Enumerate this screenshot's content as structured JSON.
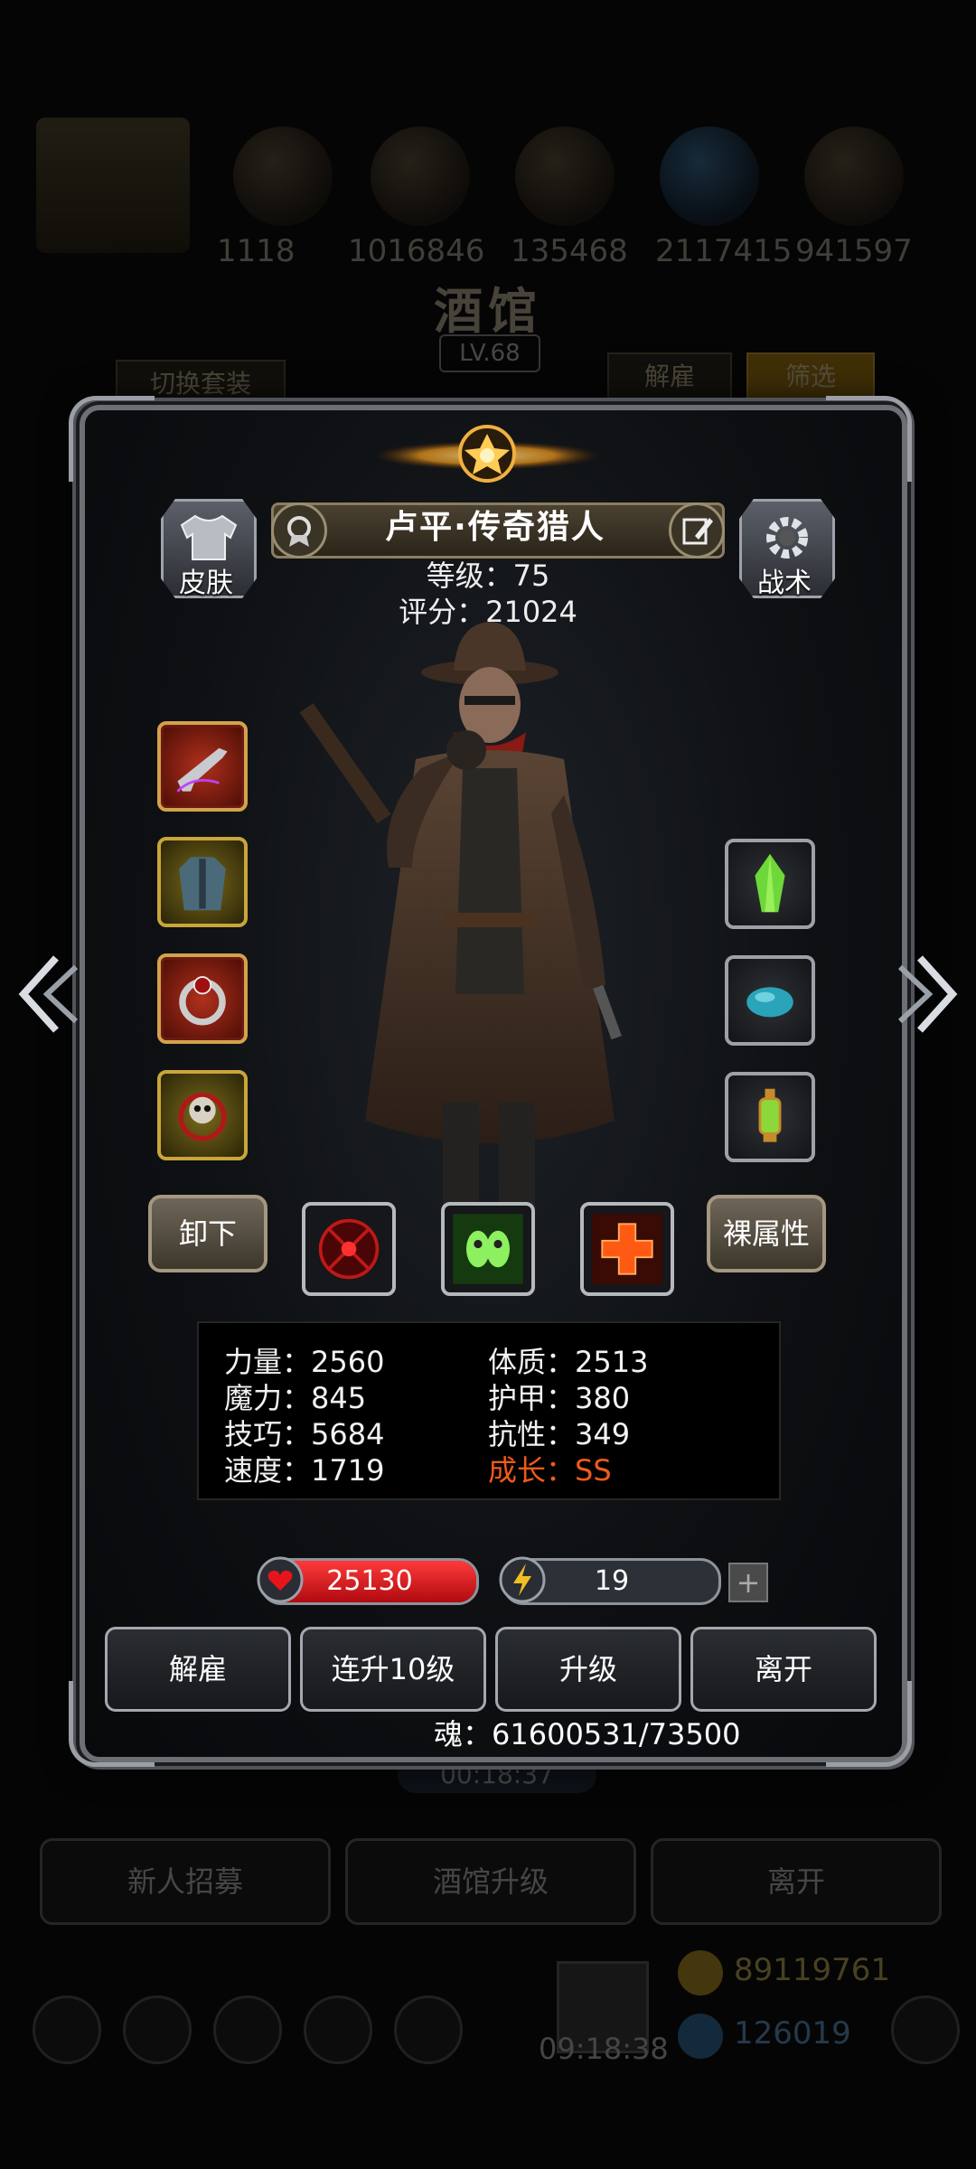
{
  "background": {
    "resource_counts": [
      "1118",
      "1016846",
      "135468",
      "2117415",
      "941597"
    ],
    "title": "酒馆",
    "level": "LV.68",
    "switch_outfit_label": "切换套装",
    "dismiss_label": "解雇",
    "filter_label": "筛选",
    "timer": "00:18:37",
    "bottom_buttons": [
      "新人招募",
      "酒馆升级",
      "离开"
    ],
    "gold": "89119761",
    "gems": "126019",
    "clock": "09:18:38"
  },
  "hero": {
    "name": "卢平·传奇猎人",
    "level_text": "等级：75",
    "score_text": "评分：21024",
    "skin_label": "皮肤",
    "tactics_label": "战术",
    "unequip_label": "卸下",
    "naked_attr_label": "裸属性"
  },
  "stats": {
    "strength": "力量：2560",
    "constitution": "体质：2513",
    "magic": "魔力：845",
    "armor": "护甲：380",
    "skill": "技巧：5684",
    "resistance": "抗性：349",
    "speed": "速度：1719",
    "growth": "成长：SS"
  },
  "bars": {
    "hp": "25130",
    "hp_fill": 1.0,
    "energy": "19",
    "energy_fill": 0.15
  },
  "actions": {
    "dismiss": "解雇",
    "level_up_10": "连升10级",
    "level_up": "升级",
    "leave": "离开"
  },
  "soul_text": "魂：61600531/73500",
  "colors": {
    "accent_gold": "#d4a24a",
    "growth": "#f05a1a",
    "hp": "#e0141c",
    "energy": "#e8c020"
  }
}
